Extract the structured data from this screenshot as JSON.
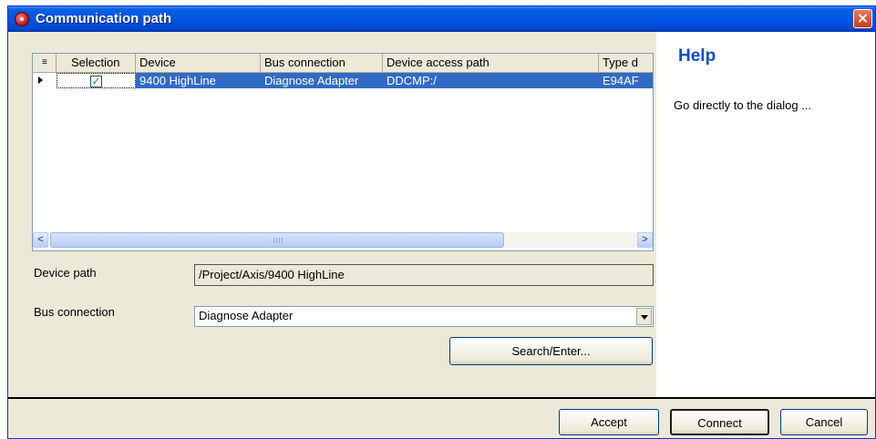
{
  "window": {
    "title": "Communication path",
    "close_glyph": "×"
  },
  "table": {
    "columns": [
      "Selection",
      "Device",
      "Bus connection",
      "Device access path",
      "Type d"
    ],
    "rows": [
      {
        "selected": true,
        "device": "9400 HighLine",
        "bus_connection": "Diagnose Adapter",
        "device_access_path": "DDCMP:/",
        "type": "E94AF"
      }
    ],
    "scroll_left": "<",
    "scroll_right": ">"
  },
  "form": {
    "device_path_label": "Device path",
    "device_path_value": "/Project/Axis/9400 HighLine",
    "bus_connection_label": "Bus connection",
    "bus_connection_value": "Diagnose Adapter",
    "search_button": "Search/Enter..."
  },
  "help": {
    "title": "Help",
    "text": "Go directly to the dialog ..."
  },
  "buttons": {
    "accept": "Accept",
    "connect": "Connect",
    "cancel": "Cancel"
  },
  "icons": {
    "title_icon": "app-icon",
    "close": "close-icon",
    "row_indicator": "row-arrow-icon",
    "checkbox": "checkmark-icon"
  }
}
